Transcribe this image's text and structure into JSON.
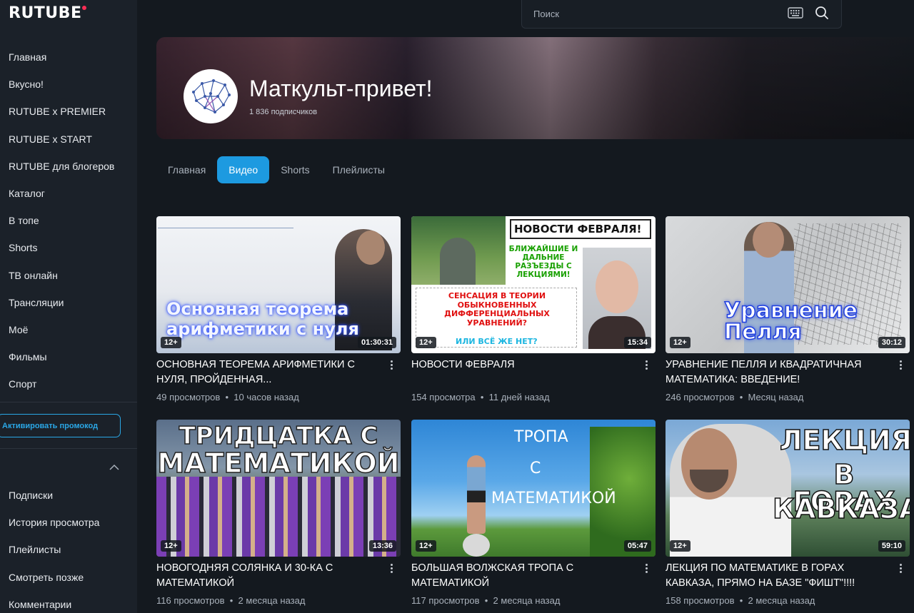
{
  "app": {
    "logo": "RUTUBE",
    "brand_color": "#ff2d55",
    "accent": "#1d9ae0"
  },
  "sidebar": {
    "items": [
      {
        "label": "Главная"
      },
      {
        "label": "Вкусно!"
      },
      {
        "label": "RUTUBE x PREMIER"
      },
      {
        "label": "RUTUBE x START"
      },
      {
        "label": "RUTUBE для блогеров"
      },
      {
        "label": "Каталог"
      },
      {
        "label": "В топе"
      },
      {
        "label": "Shorts"
      },
      {
        "label": "ТВ онлайн"
      },
      {
        "label": "Трансляции"
      },
      {
        "label": "Моё"
      },
      {
        "label": "Фильмы"
      },
      {
        "label": "Спорт"
      }
    ],
    "promo_label": "Активировать промокод",
    "items2": [
      {
        "label": "Подписки"
      },
      {
        "label": "История просмотра"
      },
      {
        "label": "Плейлисты"
      },
      {
        "label": "Смотреть позже"
      },
      {
        "label": "Комментарии"
      }
    ]
  },
  "search": {
    "placeholder": "Поиск",
    "icons": [
      "keyboard-icon",
      "search-icon"
    ]
  },
  "channel": {
    "title": "Маткульт-привет!",
    "subscribers": "1 836 подписчиков"
  },
  "tabs": [
    {
      "label": "Главная",
      "active": false
    },
    {
      "label": "Видео",
      "active": true
    },
    {
      "label": "Shorts",
      "active": false
    },
    {
      "label": "Плейлисты",
      "active": false
    }
  ],
  "videos": [
    {
      "title": "ОСНОВНАЯ ТЕОРЕМА АРИФМЕТИКИ С НУЛЯ, ПРОЙДЕННАЯ...",
      "views": "49 просмотров",
      "date": "10 часов назад",
      "duration": "01:30:31",
      "age": "12+",
      "thumb_text": [
        "Основная теорема",
        "арифметики с нуля"
      ]
    },
    {
      "title": "НОВОСТИ ФЕВРАЛЯ",
      "views": "154 просмотра",
      "date": "11 дней назад",
      "duration": "15:34",
      "age": "12+",
      "thumb_text": [
        "НОВОСТИ ФЕВРАЛЯ!",
        "БЛИЖАЙШИЕ И ДАЛЬНИЕ РАЗЪЕЗДЫ С ЛЕКЦИЯМИ!",
        "СЕНСАЦИЯ В ТЕОРИИ ОБЫКНОВЕННЫХ ДИФФЕРЕНЦИАЛЬНЫХ УРАВНЕНИЙ?",
        "ИЛИ ВСЁ ЖЕ НЕТ?"
      ]
    },
    {
      "title": "УРАВНЕНИЕ ПЕЛЛЯ И КВАДРАТИЧНАЯ МАТЕМАТИКА: ВВЕДЕНИЕ!",
      "views": "246 просмотров",
      "date": "Месяц назад",
      "duration": "30:12",
      "age": "12+",
      "thumb_text": [
        "Уравнение Пелля"
      ]
    },
    {
      "title": "НОВОГОДНЯЯ СОЛЯНКА И 30-КА С МАТЕМАТИКОЙ",
      "views": "116 просмотров",
      "date": "2 месяца назад",
      "duration": "13:36",
      "age": "12+",
      "thumb_text": [
        "ТРИДЦАТКА С",
        "МАТЕМАТИКОЙ"
      ]
    },
    {
      "title": "БОЛЬШАЯ ВОЛЖСКАЯ ТРОПА С МАТЕМАТИКОЙ",
      "views": "117 просмотров",
      "date": "2 месяца назад",
      "duration": "05:47",
      "age": "12+",
      "thumb_text": [
        "ТРОПА",
        "С",
        "МАТЕМАТИКОЙ"
      ]
    },
    {
      "title": "ЛЕКЦИЯ ПО МАТЕМАТИКЕ В ГОРАХ КАВКАЗА, ПРЯМО НА БАЗЕ \"ФИШТ\"!!!!",
      "views": "158 просмотров",
      "date": "2 месяца назад",
      "duration": "59:10",
      "age": "12+",
      "thumb_text": [
        "ЛЕКЦИЯ",
        "В ГОРАХ",
        "КАВКАЗА"
      ]
    }
  ]
}
